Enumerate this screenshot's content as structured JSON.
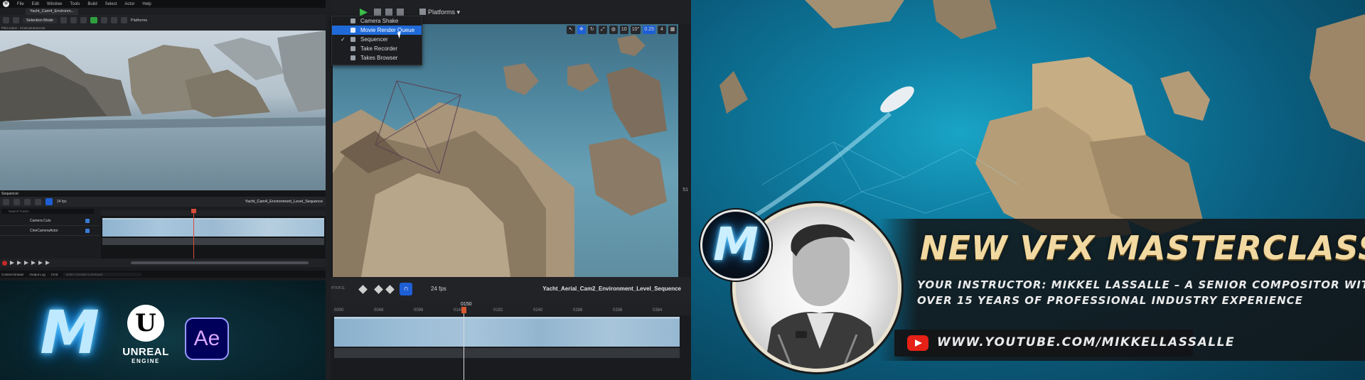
{
  "left_editor": {
    "menu": [
      "File",
      "Edit",
      "Window",
      "Tools",
      "Build",
      "Select",
      "Actor",
      "Help"
    ],
    "tab_title": "Yacht_Cam4_Environm...",
    "toolbar_mode": "Selection Mode",
    "toolbar_platforms": "Platforms",
    "viewport_label": "Pilot Active - CineCameraActor",
    "sequencer_tab": "Sequencer",
    "fps": "24 fps",
    "sequence_name": "Yacht_Cam4_Environment_Level_Sequence",
    "search_placeholder": "Search Tracks",
    "current_frame": "0150",
    "tracks": [
      "Camera Cuts",
      "CineCameraActor"
    ],
    "status": {
      "content_drawer": "Content Drawer",
      "output_log": "Output Log",
      "cmd": "Cmd",
      "cmd_placeholder": "Enter Console Command"
    }
  },
  "logos": {
    "m_letter": "M",
    "unreal_line1": "UNREAL",
    "unreal_line2": "ENGINE",
    "ae": "Ae"
  },
  "mid_editor": {
    "platforms": "Platforms",
    "dropdown": [
      {
        "label": "Camera Shake Previewer",
        "checked": false,
        "active": false
      },
      {
        "label": "Movie Render Queue",
        "checked": false,
        "active": true
      },
      {
        "label": "Sequencer",
        "checked": true,
        "active": false
      },
      {
        "label": "Take Recorder",
        "checked": false,
        "active": false
      },
      {
        "label": "Takes Browser",
        "checked": false,
        "active": false
      }
    ],
    "viewport_tools": {
      "angle": "10°",
      "grid": "10",
      "scale": "0.25",
      "speed": "4"
    },
    "right_bar_num": "51",
    "seq_toolbar": {
      "ptf": "PTF/F11",
      "fps": "24 fps",
      "sequence_name": "Yacht_Aerial_Cam2_Environment_Level_Sequence"
    },
    "current_frame": "0150",
    "ruler": [
      "0000",
      "0048",
      "0096",
      "0144",
      "0192",
      "0240",
      "0288",
      "0336",
      "0384"
    ]
  },
  "thumbnail": {
    "m_letter": "M",
    "headline": "NEW VFX MASTERCLASS!",
    "sub1": "YOUR INSTRUCTOR: MIKKEL LASSALLE – A SENIOR COMPOSITOR WITH",
    "sub2": "OVER 15 YEARS OF PROFESSIONAL INDUSTRY EXPERIENCE",
    "url": "WWW.YOUTUBE.COM/MIKKELLASSALLE"
  }
}
